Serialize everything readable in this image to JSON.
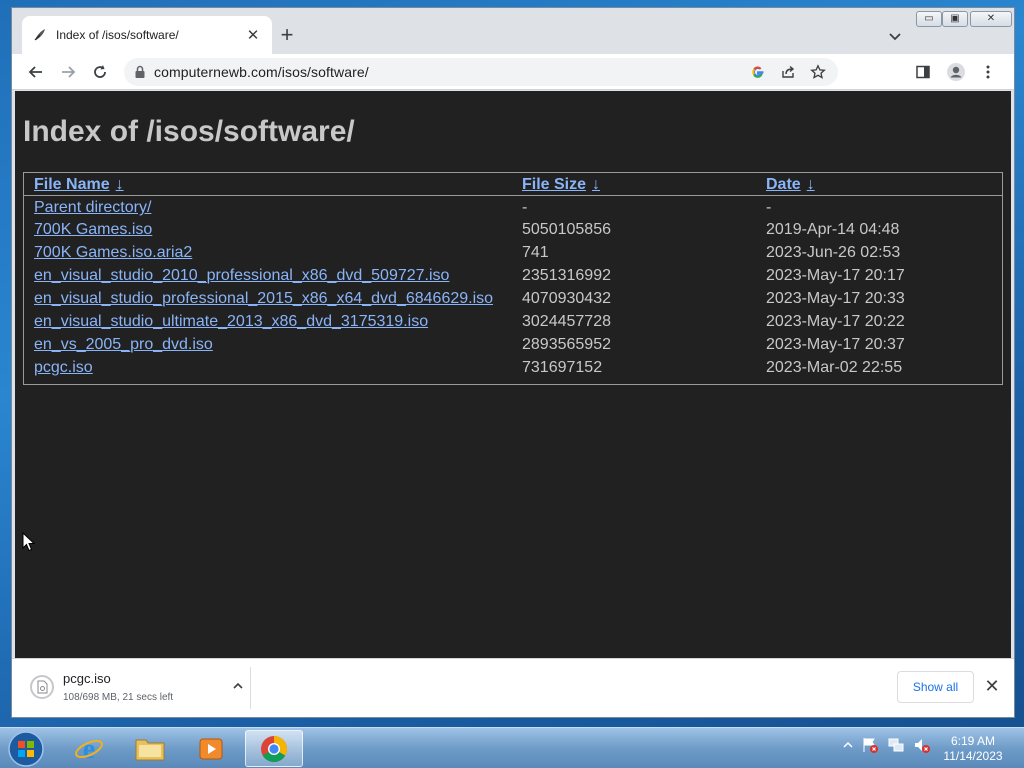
{
  "browser": {
    "tab": {
      "title": "Index of /isos/software/",
      "favicon": "apache-feather-icon"
    },
    "url": "computernewb.com/isos/software/",
    "window_controls": {
      "minimize": "▭",
      "maximize": "▣",
      "close": "✕"
    }
  },
  "page": {
    "heading": "Index of /isos/software/",
    "columns": [
      {
        "label": "File Name",
        "arrow": "↓"
      },
      {
        "label": "File Size",
        "arrow": "↓"
      },
      {
        "label": "Date",
        "arrow": "↓"
      }
    ],
    "rows": [
      {
        "name": "Parent directory/",
        "size": "-",
        "date": "-"
      },
      {
        "name": "700K Games.iso",
        "size": "5050105856",
        "date": "2019-Apr-14 04:48"
      },
      {
        "name": "700K Games.iso.aria2",
        "size": "741",
        "date": "2023-Jun-26 02:53"
      },
      {
        "name": "en_visual_studio_2010_professional_x86_dvd_509727.iso",
        "size": "2351316992",
        "date": "2023-May-17 20:17"
      },
      {
        "name": "en_visual_studio_professional_2015_x86_x64_dvd_6846629.iso",
        "size": "4070930432",
        "date": "2023-May-17 20:33"
      },
      {
        "name": "en_visual_studio_ultimate_2013_x86_dvd_3175319.iso",
        "size": "3024457728",
        "date": "2023-May-17 20:22"
      },
      {
        "name": "en_vs_2005_pro_dvd.iso",
        "size": "2893565952",
        "date": "2023-May-17 20:37"
      },
      {
        "name": "pcgc.iso",
        "size": "731697152",
        "date": "2023-Mar-02 22:55"
      }
    ]
  },
  "download_shelf": {
    "item": {
      "name": "pcgc.iso",
      "status": "108/698 MB, 21 secs left"
    },
    "show_all_label": "Show all"
  },
  "taskbar": {
    "time": "6:19 AM",
    "date": "11/14/2023",
    "apps": [
      "internet-explorer",
      "file-explorer",
      "media-player",
      "google-chrome"
    ]
  },
  "colors": {
    "page_bg": "#212121",
    "link": "#8ab4f8",
    "text": "#c8c8c8"
  }
}
